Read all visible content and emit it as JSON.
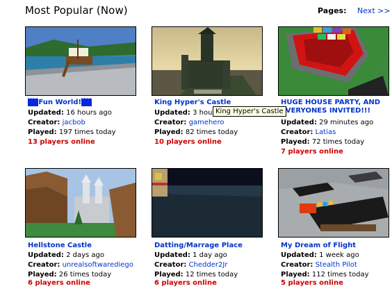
{
  "page": {
    "title": "Most Popular (Now)",
    "pages_label": "Pages:",
    "next_label": "Next >>"
  },
  "labels": {
    "updated": "Updated:",
    "creator": "Creator:",
    "played": "Played:"
  },
  "tooltip": "King Hyper's Castle",
  "games": [
    {
      "name": "Fun World!",
      "updated": "16 hours ago",
      "creator": "jacbob",
      "played": "197 times today",
      "online": "13 players online"
    },
    {
      "name": "King Hyper's Castle",
      "updated": "3 hours ago",
      "creator": "gamehero",
      "played": "82 times today",
      "online": "10 players online"
    },
    {
      "name": "HUGE HOUSE PARTY, AND EVERYONES INVITED!!!",
      "updated": "29 minutes ago",
      "creator": "Latias",
      "played": "72 times today",
      "online": "7 players online"
    },
    {
      "name": "Hellstone Castle",
      "updated": "2 days ago",
      "creator": "unrealsoftwarediego",
      "played": "26 times today",
      "online": "6 players online"
    },
    {
      "name": "Datting/Marrage Place",
      "updated": "1 day ago",
      "creator": "Chedder2Jr",
      "played": "12 times today",
      "online": "6 players online"
    },
    {
      "name": "My Dream of Flight",
      "updated": "1 week ago",
      "creator": "Stealth Pilot",
      "played": "112 times today",
      "online": "5 players online"
    }
  ]
}
